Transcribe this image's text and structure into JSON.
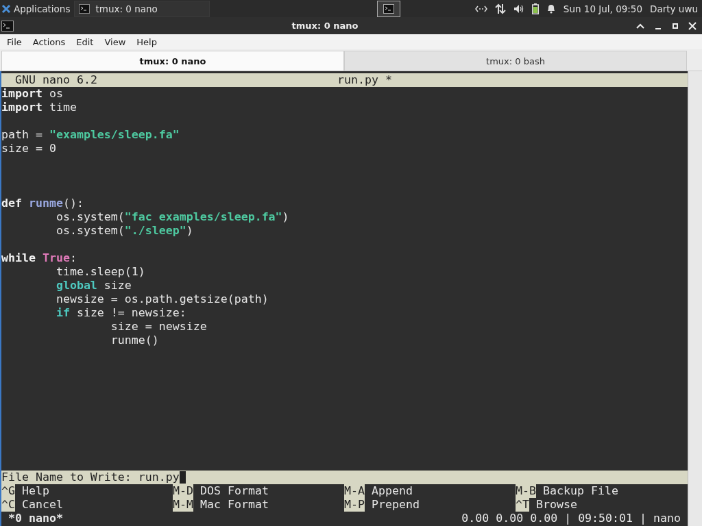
{
  "panel": {
    "apps_label": "Applications",
    "task": {
      "title": "tmux: 0 nano",
      "selected": false
    },
    "clock": "Sun 10 Jul, 09:50",
    "user": "Darty uwu"
  },
  "window": {
    "title": "tmux: 0 nano"
  },
  "menu": [
    "File",
    "Actions",
    "Edit",
    "View",
    "Help"
  ],
  "tabs": [
    {
      "label": "tmux: 0 nano",
      "selected": true
    },
    {
      "label": "tmux: 0 bash",
      "selected": false
    }
  ],
  "nano": {
    "version": "GNU nano 6.2",
    "filename": "run.py *",
    "lines": [
      {
        "kind": "code",
        "tokens": [
          {
            "text": "import",
            "kind": "keyword"
          },
          {
            "text": " os",
            "kind": "plain"
          }
        ]
      },
      {
        "kind": "code",
        "tokens": [
          {
            "text": "import",
            "kind": "keyword"
          },
          {
            "text": " time",
            "kind": "plain"
          }
        ]
      },
      {
        "kind": "blank"
      },
      {
        "kind": "code",
        "tokens": [
          {
            "text": "path = ",
            "kind": "plain"
          },
          {
            "text": "\"examples/sleep.fa\"",
            "kind": "string"
          }
        ]
      },
      {
        "kind": "code",
        "tokens": [
          {
            "text": "size = 0",
            "kind": "plain"
          }
        ]
      },
      {
        "kind": "blank"
      },
      {
        "kind": "blank"
      },
      {
        "kind": "blank"
      },
      {
        "kind": "code",
        "tokens": [
          {
            "text": "def",
            "kind": "keyword"
          },
          {
            "text": " runme",
            "kind": "function"
          },
          {
            "text": "():",
            "kind": "plain"
          }
        ]
      },
      {
        "kind": "code",
        "tokens": [
          {
            "text": "        os.system(",
            "kind": "plain"
          },
          {
            "text": "\"fac examples/sleep.fa\"",
            "kind": "string"
          },
          {
            "text": ")",
            "kind": "plain"
          }
        ]
      },
      {
        "kind": "code",
        "tokens": [
          {
            "text": "        os.system(",
            "kind": "plain"
          },
          {
            "text": "\"./sleep\"",
            "kind": "string"
          },
          {
            "text": ")",
            "kind": "plain"
          }
        ]
      },
      {
        "kind": "blank"
      },
      {
        "kind": "code",
        "tokens": [
          {
            "text": "while",
            "kind": "keyword"
          },
          {
            "text": " True",
            "kind": "constant"
          },
          {
            "text": ":",
            "kind": "plain"
          }
        ]
      },
      {
        "kind": "code",
        "tokens": [
          {
            "text": "        time.sleep(1)",
            "kind": "plain"
          }
        ]
      },
      {
        "kind": "code",
        "tokens": [
          {
            "text": "        global",
            "kind": "control"
          },
          {
            "text": " size",
            "kind": "plain"
          }
        ]
      },
      {
        "kind": "code",
        "tokens": [
          {
            "text": "        newsize = os.path.getsize(path)",
            "kind": "plain"
          }
        ]
      },
      {
        "kind": "code",
        "tokens": [
          {
            "text": "        if",
            "kind": "control"
          },
          {
            "text": " size != newsize:",
            "kind": "plain"
          }
        ]
      },
      {
        "kind": "code",
        "tokens": [
          {
            "text": "                size = newsize",
            "kind": "plain"
          }
        ]
      },
      {
        "kind": "code",
        "tokens": [
          {
            "text": "                runme()",
            "kind": "plain"
          }
        ]
      }
    ],
    "prompt": {
      "label": "File Name to Write:",
      "value": "run.py"
    },
    "shortcuts": [
      [
        {
          "key": "^G",
          "label": "Help"
        },
        {
          "key": "M-D",
          "label": "DOS Format"
        },
        {
          "key": "M-A",
          "label": "Append"
        },
        {
          "key": "M-B",
          "label": "Backup File"
        }
      ],
      [
        {
          "key": "^C",
          "label": "Cancel"
        },
        {
          "key": "M-M",
          "label": "Mac Format"
        },
        {
          "key": "M-P",
          "label": "Prepend"
        },
        {
          "key": "^T",
          "label": "Browse"
        }
      ]
    ]
  },
  "tmux_status": {
    "window": "*0 nano*",
    "right": "0.00 0.00 0.00 | 09:50:01 | nano"
  }
}
